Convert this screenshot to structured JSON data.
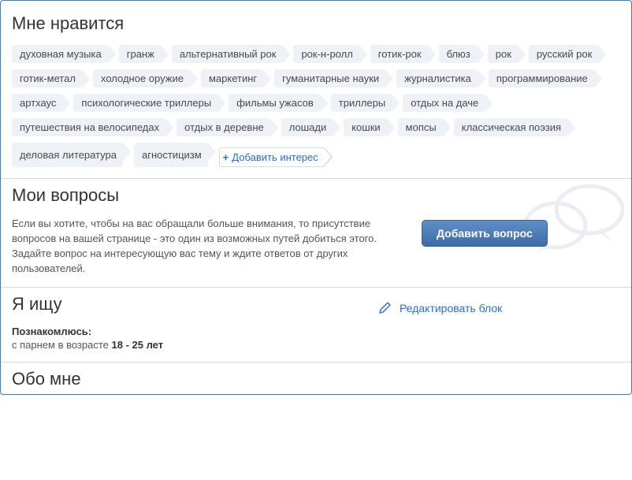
{
  "interests": {
    "title": "Мне нравится",
    "tags": [
      "духовная музыка",
      "гранж",
      "альтернативный рок",
      "рок-н-ролл",
      "готик-рок",
      "блюз",
      "рок",
      "русский рок",
      "готик-метал",
      "холодное оружие",
      "маркетинг",
      "гуманитарные науки",
      "журналистика",
      "программирование",
      "артхаус",
      "психологические триллеры",
      "фильмы ужасов",
      "триллеры",
      "отдых на даче",
      "путешествия на велосипедах",
      "отдых в деревне",
      "лошади",
      "кошки",
      "мопсы",
      "классическая поэзия",
      "деловая литература",
      "агностицизм"
    ],
    "add_label": "Добавить интерес"
  },
  "questions": {
    "title": "Мои вопросы",
    "description": "Если вы хотите, чтобы на вас обращали больше внимания, то присутствие вопросов на вашей странице - это один из возможных путей добиться этого. Задайте вопрос на интересующую вас тему и ждите ответов от других пользователей.",
    "button": "Добавить вопрос"
  },
  "seeking": {
    "title": "Я ищу",
    "edit_label": "Редактировать блок",
    "label": "Познакомлюсь:",
    "value_prefix": "с парнем в возрасте ",
    "value_range": "18 - 25 лет"
  },
  "about": {
    "title": "Обо мне"
  }
}
